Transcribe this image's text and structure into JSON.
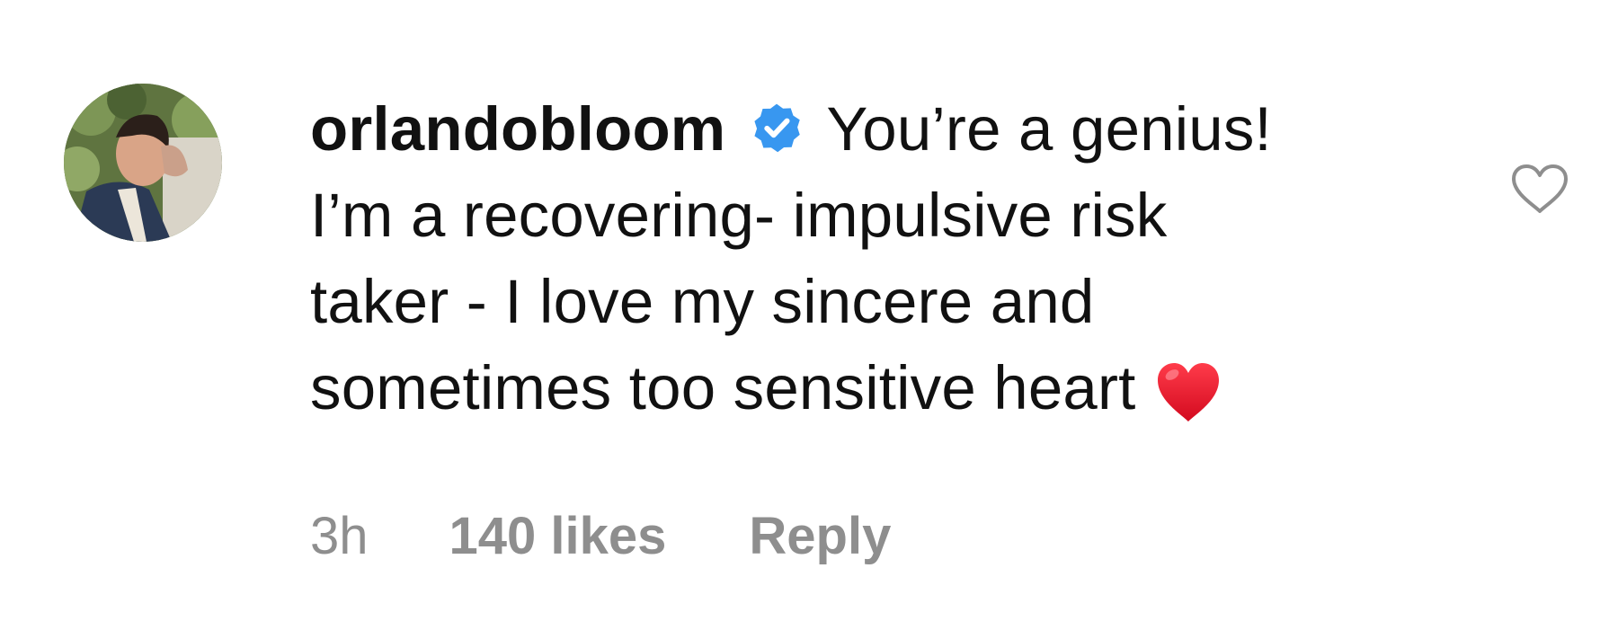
{
  "comment": {
    "username": "orlandobloom",
    "verified": true,
    "text_lines": [
      "You’re a genius!",
      "I’m a recovering- impulsive risk",
      "taker - I love my sincere and",
      "sometimes too sensitive heart"
    ],
    "emoji": "red-heart",
    "timestamp": "3h",
    "likes_label": "140 likes",
    "reply_label": "Reply",
    "like_icon": "heart-outline-icon"
  },
  "colors": {
    "text": "#111111",
    "meta": "#8e8e8e",
    "verified_badge": "#3897f0",
    "heart_emoji": "#e8132b",
    "like_outline": "#8e8e8e"
  }
}
